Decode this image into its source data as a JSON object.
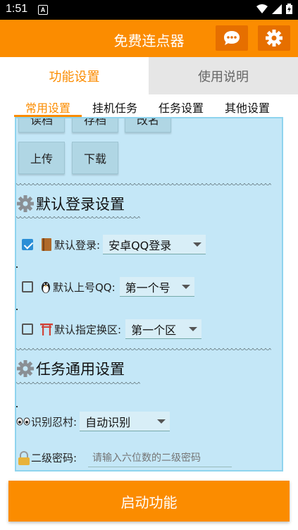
{
  "status_bar": {
    "time": "1:51",
    "notification_letter": "A"
  },
  "app_bar": {
    "title": "免费连点器",
    "chat_icon": "chat-bubble-icon",
    "settings_icon": "gear-icon"
  },
  "main_tabs": [
    {
      "label": "功能设置",
      "active": true
    },
    {
      "label": "使用说明",
      "active": false
    }
  ],
  "sub_tabs": [
    {
      "label": "常用设置",
      "active": true
    },
    {
      "label": "挂机任务",
      "active": false
    },
    {
      "label": "任务设置",
      "active": false
    },
    {
      "label": "其他设置",
      "active": false
    }
  ],
  "top_buttons": {
    "read_save": "读档",
    "save": "存档",
    "rename": "改名",
    "upload": "上传",
    "download": "下载"
  },
  "section_login": {
    "title": "默认登录设置",
    "login": {
      "label": "默认登录:",
      "value": "安卓QQ登录",
      "checked": true
    },
    "account": {
      "label": "默认上号QQ:",
      "value": "第一个号",
      "checked": false
    },
    "zone": {
      "label": "默认指定换区:",
      "value": "第一个区",
      "checked": false
    }
  },
  "section_task": {
    "title": "任务通用设置",
    "village": {
      "label": "识别忍村:",
      "value": "自动识别"
    },
    "password": {
      "label": "二级密码:",
      "placeholder": "请输入六位数的二级密码"
    }
  },
  "start_button": "启动功能",
  "colors": {
    "accent": "#fb8c00",
    "panel": "#c4e7f7"
  }
}
